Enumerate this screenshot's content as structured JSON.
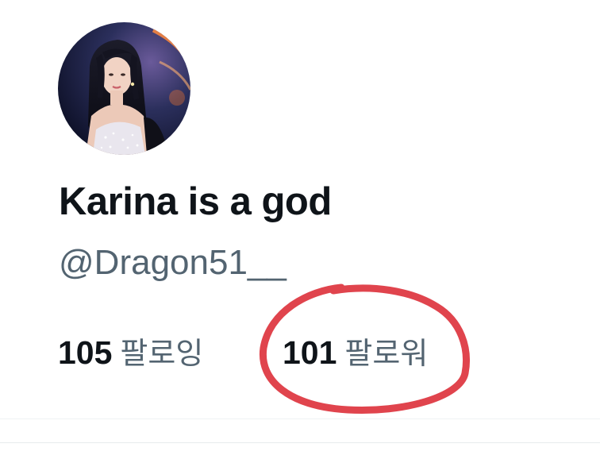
{
  "profile": {
    "display_name": "Karina is a god",
    "handle": "@Dragon51__",
    "avatar_icon": "profile-photo"
  },
  "stats": {
    "following_count": "105",
    "following_label": "팔로잉",
    "followers_count": "101",
    "followers_label": "팔로워"
  },
  "annotation": {
    "color": "#e0444d"
  }
}
